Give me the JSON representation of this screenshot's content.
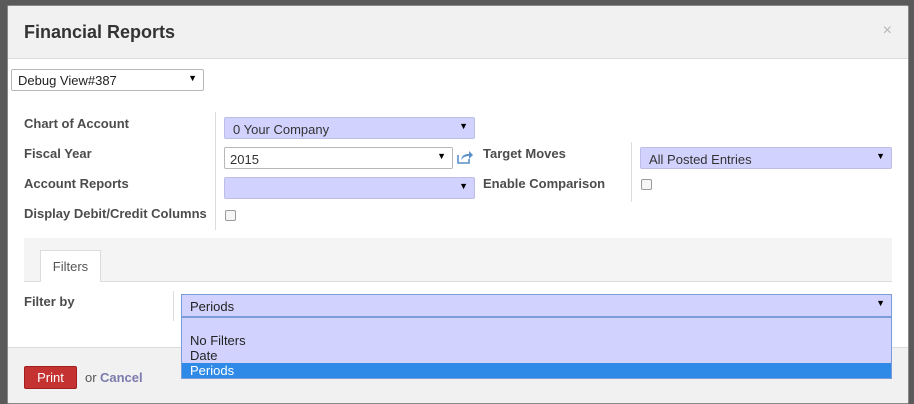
{
  "dialog": {
    "title": "Financial Reports",
    "close_glyph": "×"
  },
  "debug": {
    "value": "Debug View#387"
  },
  "form": {
    "chart_of_account_label": "Chart of Account",
    "chart_of_account_value": "0 Your Company",
    "fiscal_year_label": "Fiscal Year",
    "fiscal_year_value": "2015",
    "target_moves_label": "Target Moves",
    "target_moves_value": "All Posted Entries",
    "account_reports_label": "Account Reports",
    "account_reports_value": "",
    "enable_comparison_label": "Enable Comparison",
    "display_debit_credit_label": "Display Debit/Credit Columns",
    "enable_comparison_checked": false,
    "display_debit_credit_checked": false
  },
  "tabs": [
    {
      "label": "Filters",
      "active": true
    }
  ],
  "filter": {
    "label": "Filter by",
    "value": "Periods",
    "options": [
      "No Filters",
      "Date",
      "Periods"
    ],
    "selected_index": 2
  },
  "footer": {
    "print_label": "Print",
    "or_text": "or",
    "cancel_label": "Cancel"
  },
  "colors": {
    "required_field": "#d2d2ff",
    "print_button": "#c53232",
    "selected_option": "#2e8ae6",
    "cancel_link": "#7c7bad"
  },
  "icons": {
    "external_link": "external-link-icon",
    "caret": "caret-down-icon",
    "close": "close-icon"
  }
}
